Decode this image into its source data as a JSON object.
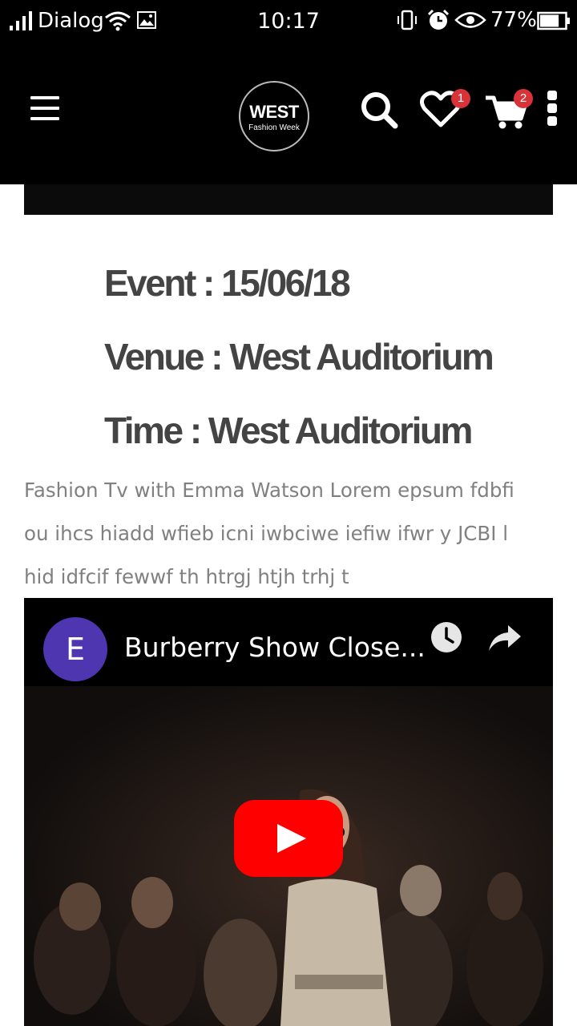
{
  "status_bar": {
    "carrier": "Dialog",
    "time": "10:17",
    "battery_percent": "77%",
    "battery_level": 0.77,
    "icons": [
      "signal-icon",
      "wifi-icon",
      "gallery-icon",
      "vibrate-icon",
      "alarm-icon",
      "eye-icon",
      "battery-icon"
    ]
  },
  "header": {
    "logo_main": "WEST",
    "logo_sub": "Fashion Week",
    "wishlist_count": "1",
    "cart_count": "2",
    "icons": [
      "menu-icon",
      "search-icon",
      "heart-icon",
      "cart-icon",
      "more-icon"
    ]
  },
  "event": {
    "date_line": "Event : 15/06/18",
    "venue_line": "Venue : West Auditorium",
    "time_line": "Time : West Auditorium",
    "description_lines": [
      "Fashion Tv with Emma Watson Lorem epsum fdbfi",
      "ou ihcs hiadd wfieb icni iwbciwe iefiw ifwr y JCBI l",
      "hid idfcif fewwf th htrgj htjh trhj t"
    ]
  },
  "video": {
    "channel_initial": "E",
    "title": "Burberry Show Close...",
    "icons": [
      "watch-later-icon",
      "share-icon",
      "play-icon"
    ],
    "colors": {
      "avatar": "#4f36b1",
      "play_button": "#ff0000"
    }
  }
}
